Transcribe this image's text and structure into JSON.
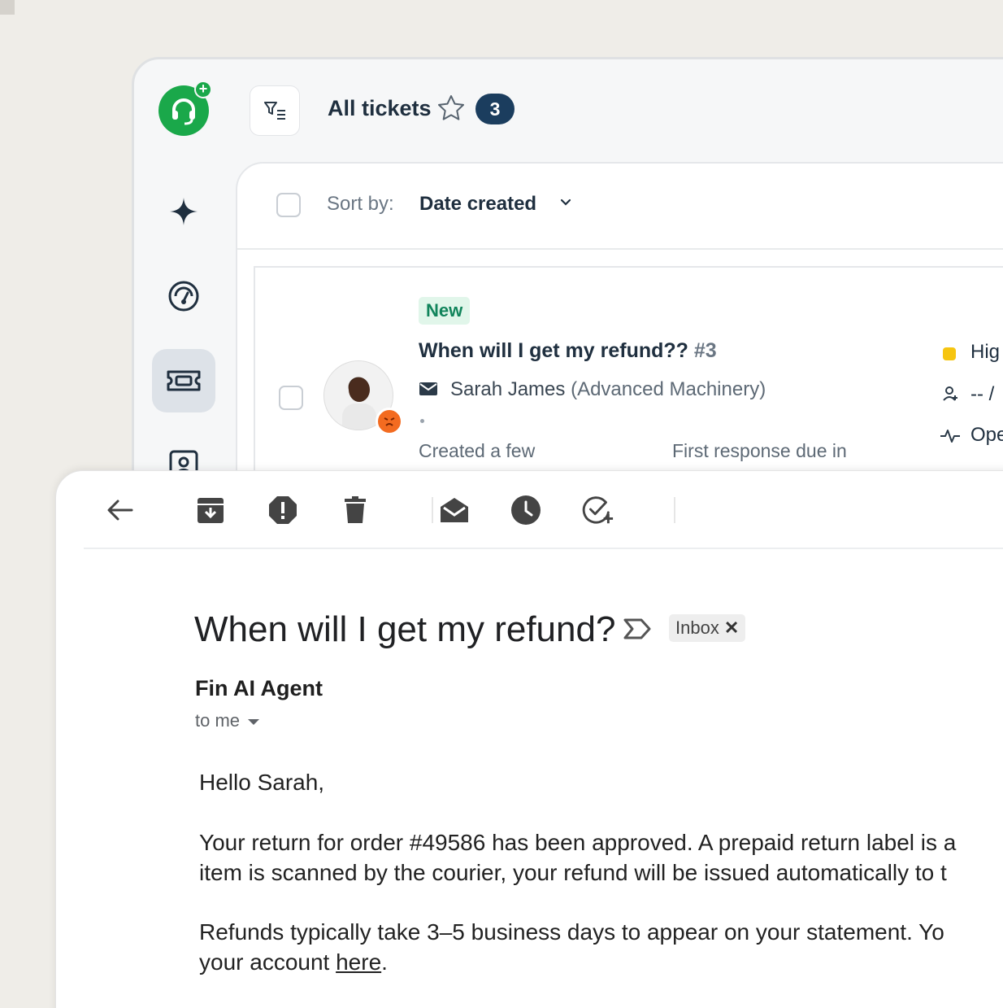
{
  "helpdesk": {
    "view_title": "All tickets",
    "ticket_count": "3",
    "sort": {
      "label": "Sort by:",
      "value": "Date created"
    },
    "ticket": {
      "status": "New",
      "subject": "When will I get my refund??",
      "number": "#3",
      "requester_name": "Sarah James",
      "requester_org": "(Advanced Machinery)",
      "created": "Created a few",
      "first_response": "First response due in",
      "priority": "Hig",
      "assignee": "-- /",
      "state": "Ope"
    },
    "colors": {
      "brand": "#1aa84a",
      "count_badge": "#1b3d5e",
      "priority_high": "#f6c510",
      "new_badge_bg": "#e1f6ea",
      "new_badge_text": "#11845b"
    },
    "nav_icons": [
      "sparkle-icon",
      "dashboard-gauge-icon",
      "ticket-icon",
      "contact-card-icon"
    ]
  },
  "email": {
    "toolbar_icons": [
      "back-arrow-icon",
      "archive-icon",
      "report-spam-icon",
      "delete-icon",
      "mark-unread-icon",
      "snooze-icon",
      "add-task-icon"
    ],
    "subject": "When will I get my refund?",
    "label_chip": "Inbox",
    "sender": "Fin AI Agent",
    "recipient": "to me",
    "body": {
      "greeting": "Hello Sarah,",
      "para1_line1": "Your return for order #49586 has been approved. A prepaid return label is a",
      "para1_line2": "item is scanned by the courier, your refund will be issued automatically to t",
      "para2_line1": "Refunds typically take 3–5 business days to appear on your statement. Yo",
      "para2_line2_prefix": "your account ",
      "para2_link": "here",
      "para2_line2_suffix": "."
    }
  }
}
